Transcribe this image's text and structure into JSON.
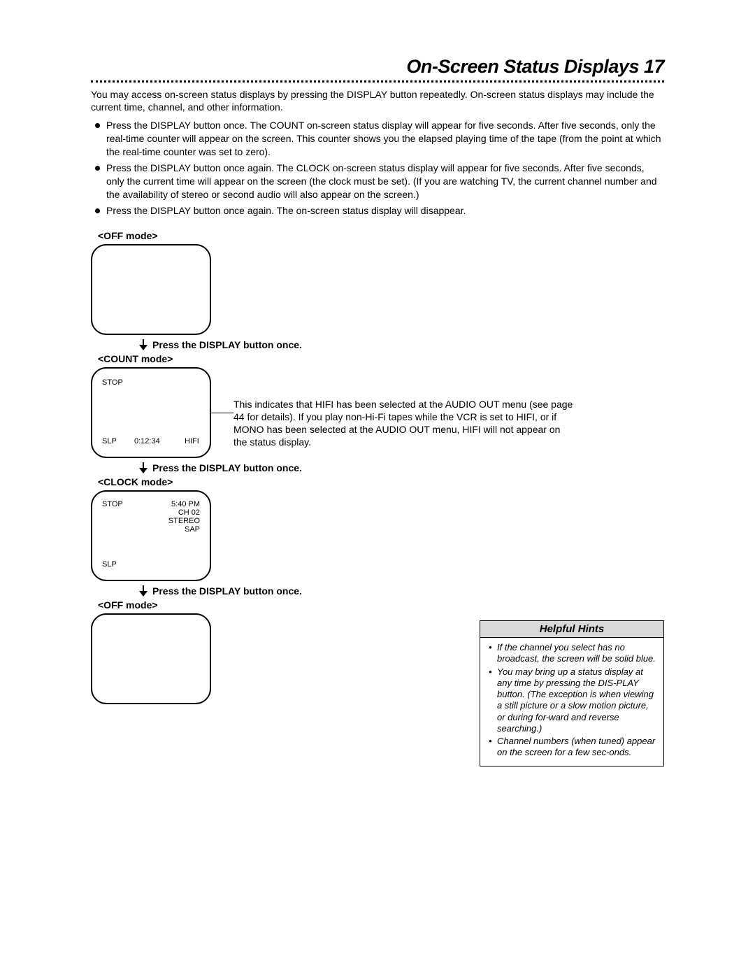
{
  "title": "On-Screen Status Displays 17",
  "intro": "You may access on-screen status displays by pressing the DISPLAY button repeatedly. On-screen status displays may include the current time, channel, and other information.",
  "bullets": [
    "Press the DISPLAY button once. The COUNT on-screen status display will appear for five seconds. After five seconds, only the real-time counter will appear on the screen. This counter shows you the elapsed playing time of the tape (from the point at which the real-time counter was set to zero).",
    "Press the DISPLAY button once again. The CLOCK on-screen status display will appear for five seconds. After five seconds, only the current time will appear on the screen (the clock must be set). (If you are watching TV, the current channel number and the availability of stereo or second audio will also appear on the screen.)",
    "Press the DISPLAY button once again. The on-screen status display will disappear."
  ],
  "modes": {
    "off1": "<OFF mode>",
    "count": "<COUNT mode>",
    "clock": "<CLOCK mode>",
    "off2": "<OFF mode>"
  },
  "press_label": "Press the DISPLAY button once.",
  "screen_count": {
    "stop": "STOP",
    "slp": "SLP",
    "counter": "0:12:34",
    "hifi": "HIFI"
  },
  "screen_clock": {
    "stop": "STOP",
    "time": "5:40 PM",
    "ch": "CH 02",
    "stereo": "STEREO",
    "sap": "SAP",
    "slp": "SLP"
  },
  "hifi_note": "This indicates that HIFI has been selected at the AUDIO OUT menu  (see page 44 for details).  If you play non-Hi-Fi tapes while the VCR is set to HIFI, or if MONO has been selected at the AUDIO OUT menu, HIFI will not appear on the status display.",
  "hints": {
    "title": "Helpful Hints",
    "items": [
      "If the channel you select has no broadcast, the screen will be solid blue.",
      "You may bring up a status display at any time by pressing the DIS-PLAY button. (The exception is when viewing a still picture or a slow motion picture, or during for-ward and reverse searching.)",
      "Channel numbers (when tuned) appear on the screen for a few sec-onds."
    ]
  }
}
